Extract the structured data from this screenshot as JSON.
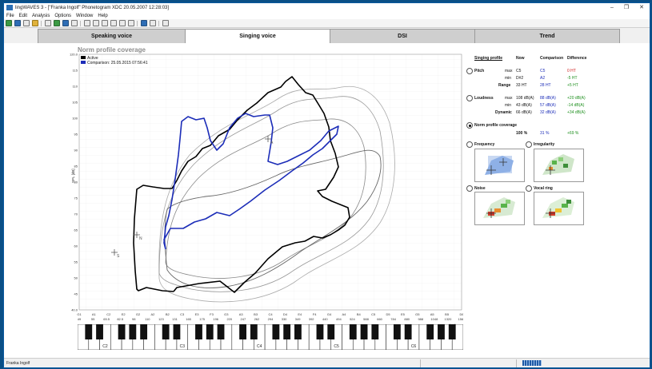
{
  "window": {
    "title": "lingWAVES 3 - [\"Franka Ingolf\" Phonetogram XDC 20.05.2007 12:28:03]",
    "minimize": "–",
    "maximize": "❐",
    "close": "✕"
  },
  "menu": [
    "File",
    "Edit",
    "Analysis",
    "Options",
    "Window",
    "Help"
  ],
  "tabs": [
    {
      "label": "Speaking voice",
      "active": false
    },
    {
      "label": "Singing voice",
      "active": true
    },
    {
      "label": "DSI",
      "active": false
    },
    {
      "label": "Trend",
      "active": false
    }
  ],
  "chart": {
    "title": "Norm profile coverage",
    "ylabel": "SPL [dB]",
    "xlabel": "Frequency [Hz]",
    "yticks": [
      "120.0",
      "115",
      "110",
      "105",
      "100",
      "95",
      "90",
      "85",
      "80",
      "75",
      "70",
      "65",
      "60",
      "55",
      "50",
      "45",
      "40.0"
    ],
    "legend": [
      {
        "label": "Active",
        "color": "#000000"
      },
      {
        "label": "Comparison: 25.05.2015 07:56:41",
        "color": "#1c2db8"
      }
    ],
    "notes_row": [
      "G1",
      "A1",
      "C2",
      "E2",
      "G2",
      "A2",
      "B2",
      "C3",
      "E3",
      "F3",
      "G3",
      "A3",
      "B3",
      "C4",
      "D4",
      "E4",
      "F4",
      "G4",
      "A4",
      "B4",
      "C5",
      "D5",
      "E5",
      "G5",
      "A5",
      "B5",
      "D6"
    ],
    "freq_row": [
      "49",
      "55",
      "65.5",
      "82.5",
      "98",
      "110",
      "123",
      "131",
      "165",
      "175",
      "196",
      "220",
      "247",
      "262",
      "294",
      "330",
      "349",
      "392",
      "440",
      "494",
      "524",
      "588",
      "660",
      "784",
      "880",
      "988",
      "1048",
      "1320",
      "1568"
    ],
    "marks": [
      "A",
      "S",
      "N"
    ],
    "piano_c_labels": [
      "C2",
      "C3",
      "C4",
      "C5",
      "C6"
    ]
  },
  "singing_profile": {
    "heading": "Singing profile",
    "col_now": "Now",
    "col_comparison": "Comparison",
    "col_difference": "Difference",
    "pitch": {
      "label": "Pitch",
      "max": [
        "max",
        "C5",
        "C5",
        "0 HT"
      ],
      "min": [
        "min",
        "D#2",
        "A2",
        "-5 HT"
      ],
      "range": [
        "Range",
        "33 HT",
        "28 HT",
        "+5 HT"
      ]
    },
    "loudness": {
      "label": "Loudness",
      "max": [
        "max",
        "108 dB(A)",
        "88 dB(A)",
        "+20 dB(A)"
      ],
      "min": [
        "min",
        "43 dB(A)",
        "57 dB(A)",
        "-14 dB(A)"
      ],
      "dynamic": [
        "Dynamic",
        "66 dB(A)",
        "32 dB(A)",
        "+34 dB(A)"
      ]
    },
    "coverage": {
      "label": "Norm profile coverage",
      "now": "100 %",
      "comparison": "31 %",
      "difference": "+69 %"
    },
    "thumbs": [
      "Frequency",
      "Irregularity",
      "Noise",
      "Vocal ring"
    ]
  },
  "status": {
    "user": "Franka Ingolf"
  },
  "colors": {
    "active": "#000000",
    "comparison": "#1c2db8",
    "diff_neg": "#d01e1e",
    "diff_pos": "#1d8f1d",
    "norm": "#9a9a9a"
  }
}
